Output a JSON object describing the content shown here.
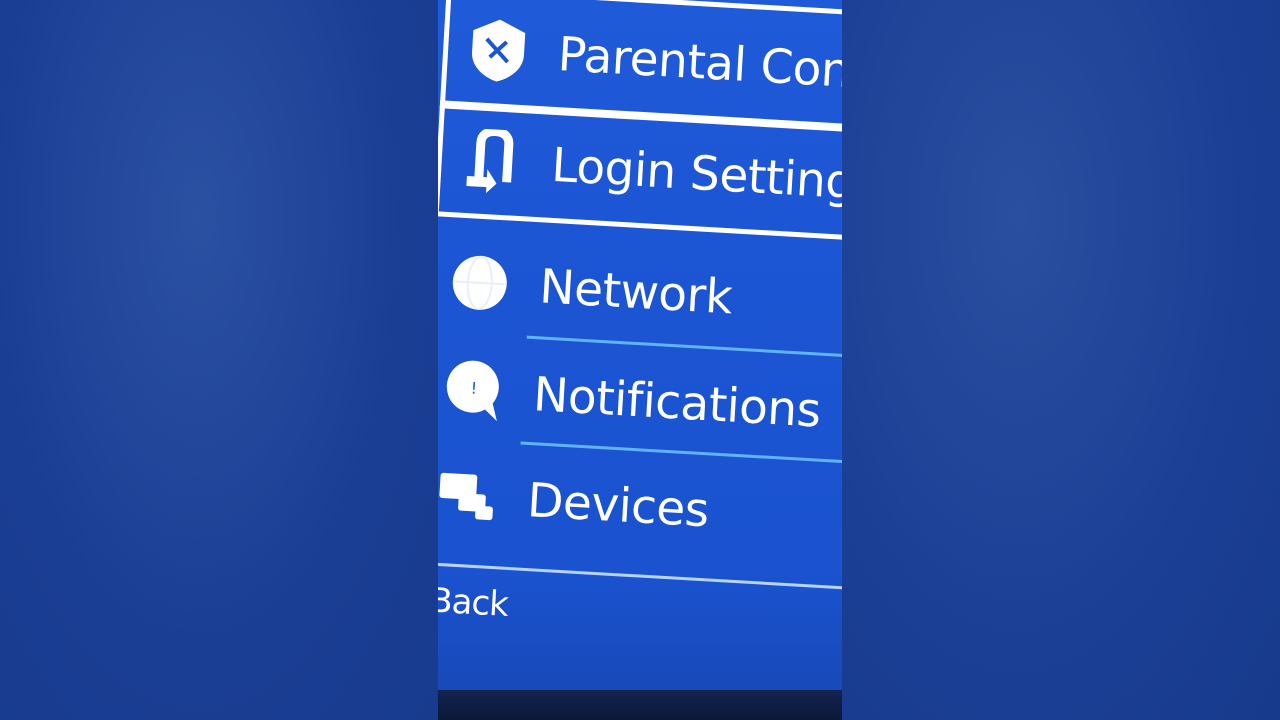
{
  "menu": {
    "items": [
      {
        "label": "Parental Con",
        "icon": "shield-icon"
      },
      {
        "label": "Login Setting",
        "icon": "login-door-icon"
      },
      {
        "label": "Network",
        "icon": "globe-icon"
      },
      {
        "label": "Notifications",
        "icon": "speech-bubble-icon"
      },
      {
        "label": "Devices",
        "icon": "devices-icon"
      }
    ]
  },
  "footer": {
    "back_label": "Back"
  },
  "colors": {
    "screen_blue": "#1c55d3",
    "separator": "#5fb4ff",
    "text": "#ffffff"
  }
}
